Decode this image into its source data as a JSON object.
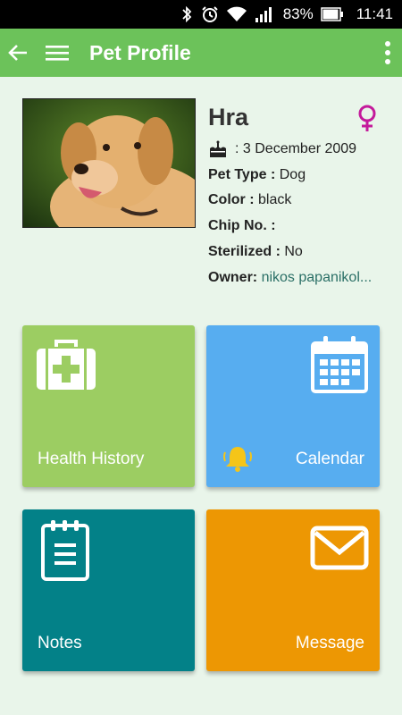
{
  "status_bar": {
    "battery": "83%",
    "time": "11:41"
  },
  "app_bar": {
    "title": "Pet Profile"
  },
  "pet": {
    "name": "Hra",
    "birth_date": ": 3 December 2009",
    "type_label": "Pet Type :",
    "type_value": "Dog",
    "color_label": "Color :",
    "color_value": "black",
    "chip_label": "Chip No. :",
    "chip_value": "",
    "sterilized_label": "Sterilized :",
    "sterilized_value": "No",
    "owner_label": "Owner:",
    "owner_value": "nikos papanikol..."
  },
  "tiles": {
    "health": "Health History",
    "calendar": "Calendar",
    "notes": "Notes",
    "message": "Message"
  },
  "colors": {
    "app_bar": "#6cc25a",
    "background": "#e9f5ea",
    "health_tile": "#9ccd62",
    "calendar_tile": "#57adf0",
    "notes_tile": "#038188",
    "message_tile": "#ed9703",
    "gender": "#c41a9b",
    "bell": "#f5c518"
  }
}
